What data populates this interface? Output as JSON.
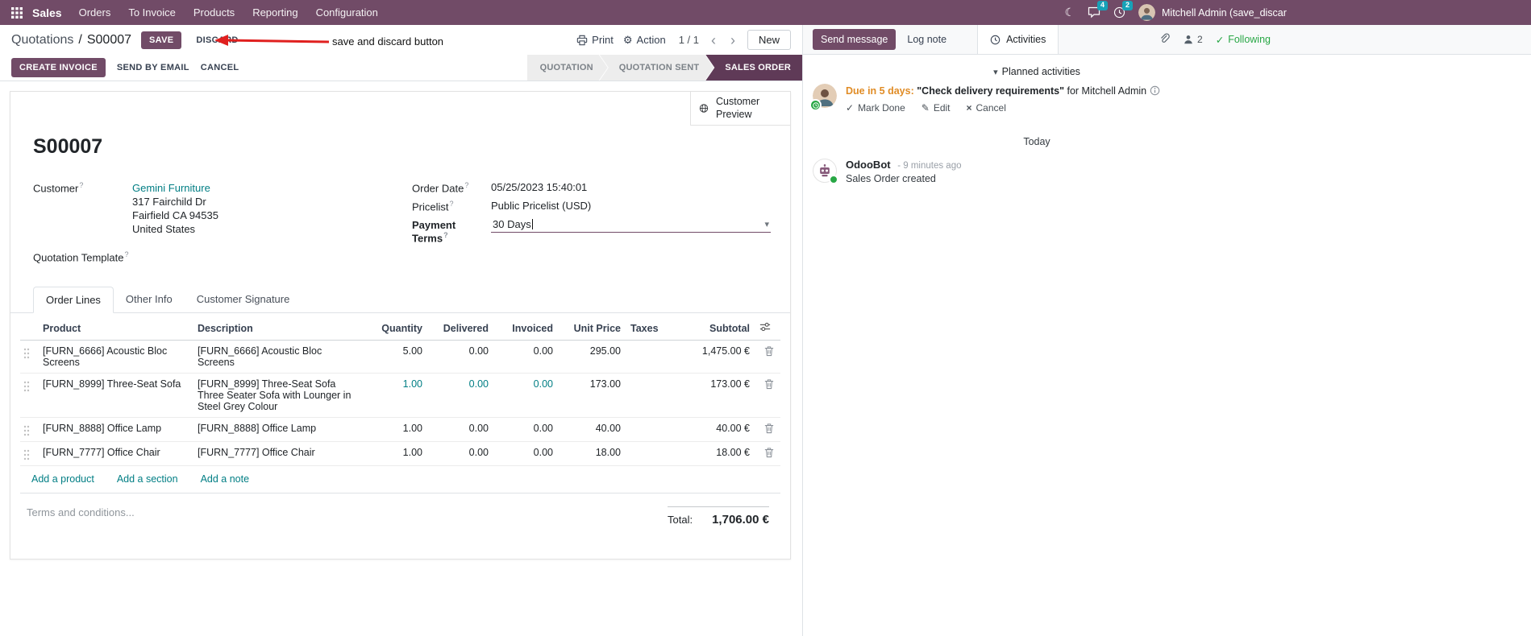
{
  "nav": {
    "app_name": "Sales",
    "menus": [
      "Orders",
      "To Invoice",
      "Products",
      "Reporting",
      "Configuration"
    ],
    "chat_badge": "4",
    "activity_badge": "2",
    "user_name": "Mitchell Admin (save_discar"
  },
  "control_panel": {
    "breadcrumb_parent": "Quotations",
    "breadcrumb_sep": "/",
    "breadcrumb_current": "S00007",
    "save_label": "SAVE",
    "discard_label": "DISCARD",
    "annotation_text": "save and discard button",
    "print_label": "Print",
    "action_label": "Action",
    "pager": "1 / 1",
    "new_label": "New"
  },
  "statusbar": {
    "create_invoice": "CREATE INVOICE",
    "send_by_email": "SEND BY EMAIL",
    "cancel": "CANCEL",
    "states": [
      {
        "label": "QUOTATION",
        "active": false
      },
      {
        "label": "QUOTATION SENT",
        "active": false
      },
      {
        "label": "SALES ORDER",
        "active": true
      }
    ]
  },
  "sheet": {
    "help_marker": "?",
    "customer_preview": "Customer Preview",
    "title": "S00007",
    "customer_label": "Customer",
    "customer_name": "Gemini Furniture",
    "address_line1": "317 Fairchild Dr",
    "address_line2": "Fairfield CA 94535",
    "address_line3": "United States",
    "quotation_template_label": "Quotation Template",
    "order_date_label": "Order Date",
    "order_date_value": "05/25/2023 15:40:01",
    "pricelist_label": "Pricelist",
    "pricelist_value": "Public Pricelist (USD)",
    "payment_terms_label": "Payment Terms",
    "payment_terms_value": "30 Days",
    "tabs": [
      {
        "label": "Order Lines"
      },
      {
        "label": "Other Info"
      },
      {
        "label": "Customer Signature"
      }
    ],
    "table": {
      "headers": {
        "product": "Product",
        "description": "Description",
        "quantity": "Quantity",
        "delivered": "Delivered",
        "invoiced": "Invoiced",
        "unit_price": "Unit Price",
        "taxes": "Taxes",
        "subtotal": "Subtotal"
      },
      "rows": [
        {
          "product": "[FURN_6666] Acoustic Bloc Screens",
          "description": "[FURN_6666] Acoustic Bloc Screens",
          "description2": "",
          "quantity": "5.00",
          "delivered": "0.00",
          "invoiced": "0.00",
          "unit_price": "295.00",
          "taxes": "",
          "subtotal": "1,475.00 €"
        },
        {
          "product": "[FURN_8999] Three-Seat Sofa",
          "description": "[FURN_8999] Three-Seat Sofa",
          "description2": "Three Seater Sofa with Lounger in Steel Grey Colour",
          "quantity": "1.00",
          "delivered": "0.00",
          "invoiced": "0.00",
          "unit_price": "173.00",
          "taxes": "",
          "subtotal": "173.00 €"
        },
        {
          "product": "[FURN_8888] Office Lamp",
          "description": "[FURN_8888] Office Lamp",
          "description2": "",
          "quantity": "1.00",
          "delivered": "0.00",
          "invoiced": "0.00",
          "unit_price": "40.00",
          "taxes": "",
          "subtotal": "40.00 €"
        },
        {
          "product": "[FURN_7777] Office Chair",
          "description": "[FURN_7777] Office Chair",
          "description2": "",
          "quantity": "1.00",
          "delivered": "0.00",
          "invoiced": "0.00",
          "unit_price": "18.00",
          "taxes": "",
          "subtotal": "18.00 €"
        }
      ],
      "add_product": "Add a product",
      "add_section": "Add a section",
      "add_note": "Add a note"
    },
    "terms_placeholder": "Terms and conditions...",
    "total_label": "Total:",
    "total_value": "1,706.00 €"
  },
  "chatter": {
    "send_message": "Send message",
    "log_note": "Log note",
    "activities": "Activities",
    "followers_count": "2",
    "following": "Following",
    "planned_header": "Planned activities",
    "activity": {
      "due": "Due in 5 days:",
      "summary": "\"Check delivery requirements\"",
      "assignee": "for Mitchell Admin",
      "mark_done": "Mark Done",
      "edit": "Edit",
      "cancel": "Cancel"
    },
    "date_divider": "Today",
    "message": {
      "author": "OdooBot",
      "timestamp": "- 9 minutes ago",
      "body": "Sales Order created"
    }
  }
}
